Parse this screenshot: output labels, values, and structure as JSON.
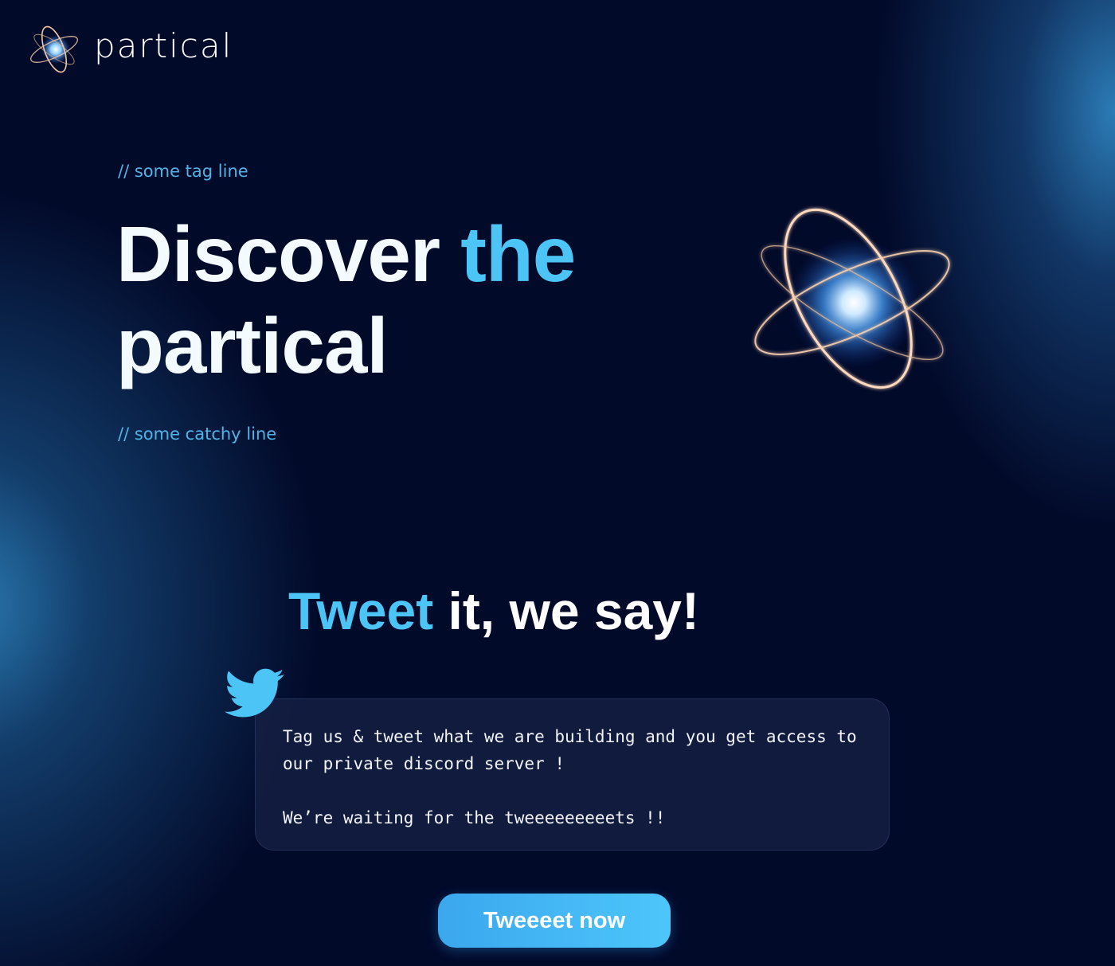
{
  "brand": {
    "name": "partical",
    "logo_icon": "atom-icon"
  },
  "hero": {
    "tagline": "// some tag line",
    "title_part1": "Discover ",
    "title_accent": "the",
    "title_part2": "partical",
    "catchy_line": "// some catchy line",
    "illustration_icon": "atom-icon"
  },
  "tweet_section": {
    "heading_accent": "Tweet",
    "heading_rest": " it, we say!",
    "icon": "twitter-icon",
    "card_line1": "Tag us & tweet what we are building and you get access to our private discord server !",
    "card_line2": "We’re waiting for the tweeeeeeeeets !!",
    "button_label": "Tweeeet now"
  },
  "colors": {
    "background": "#020a2a",
    "accent": "#4cc4f6",
    "tagline": "#4fb3e8",
    "button": "#4dc6fb",
    "card": "#161f44"
  }
}
